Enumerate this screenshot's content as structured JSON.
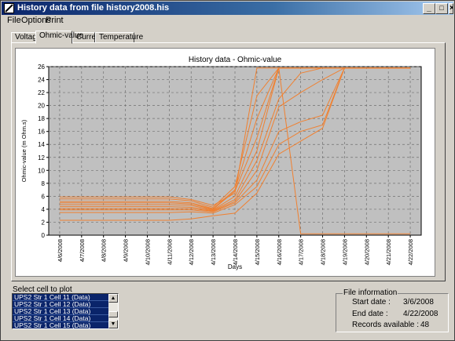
{
  "window": {
    "title": "History data from file history2008.his",
    "controls": [
      "_",
      "□",
      "×"
    ]
  },
  "menu": [
    "File",
    "Options",
    "Print"
  ],
  "tabs": [
    {
      "label": "Voltage",
      "active": false
    },
    {
      "label": "Ohmic-value",
      "active": true
    },
    {
      "label": "Current",
      "active": false
    },
    {
      "label": "Temperature",
      "active": false
    }
  ],
  "chart_data": {
    "type": "line",
    "title": "History data - Ohmic-value",
    "xlabel": "Days",
    "ylabel": "Ohmic-value (m Ohm.s)",
    "categories": [
      "4/6/2008",
      "4/7/2008",
      "4/8/2008",
      "4/9/2008",
      "4/10/2008",
      "4/11/2008",
      "4/12/2008",
      "4/13/2008",
      "4/14/2008",
      "4/15/2008",
      "4/16/2008",
      "4/17/2008",
      "4/18/2008",
      "4/19/2008",
      "4/20/2008",
      "4/21/2008",
      "4/22/2008"
    ],
    "ylim": [
      0,
      26
    ],
    "yticks": [
      0,
      2,
      4,
      6,
      8,
      10,
      12,
      14,
      16,
      18,
      20,
      22,
      24,
      26
    ],
    "grid": true,
    "line_color": "#f08030",
    "plot_bg": "#c0c0c0",
    "series": [
      {
        "values": [
          5.9,
          5.9,
          5.9,
          5.9,
          5.9,
          5.9,
          5.5,
          4.6,
          6.5,
          25.8,
          25.8,
          25.8,
          25.8,
          25.8,
          25.8,
          25.8,
          25.8
        ]
      },
      {
        "values": [
          5.6,
          5.6,
          5.6,
          5.6,
          5.6,
          5.6,
          5.3,
          4.3,
          7.5,
          21.5,
          25.8,
          25.8,
          25.8,
          25.8,
          25.8,
          25.8,
          25.8
        ]
      },
      {
        "values": [
          5.2,
          5.2,
          5.2,
          5.2,
          5.2,
          5.2,
          5.0,
          4.1,
          7.0,
          18.0,
          25.8,
          25.8,
          25.8,
          25.8,
          25.8,
          25.8,
          25.8
        ]
      },
      {
        "values": [
          5.0,
          5.0,
          5.0,
          5.0,
          5.0,
          5.0,
          4.8,
          4.0,
          6.8,
          15.0,
          25.8,
          25.8,
          25.8,
          25.8,
          25.8,
          25.8,
          25.8
        ]
      },
      {
        "values": [
          4.7,
          4.7,
          4.7,
          4.7,
          4.7,
          4.7,
          4.6,
          3.9,
          6.0,
          13.0,
          25.8,
          0.2,
          0.2,
          0.2,
          0.2,
          0.2,
          0.2
        ]
      },
      {
        "values": [
          4.4,
          4.4,
          4.4,
          4.4,
          4.4,
          4.4,
          4.3,
          3.8,
          5.5,
          11.5,
          21.0,
          25.0,
          25.8,
          25.8,
          25.8,
          25.8,
          25.8
        ]
      },
      {
        "values": [
          4.1,
          4.1,
          4.1,
          4.1,
          4.1,
          4.1,
          4.1,
          3.7,
          5.2,
          10.0,
          19.8,
          22.0,
          24.0,
          25.8,
          25.8,
          25.8,
          25.8
        ]
      },
      {
        "values": [
          3.9,
          3.9,
          3.9,
          3.9,
          3.9,
          3.9,
          3.9,
          3.6,
          5.0,
          8.5,
          16.0,
          17.5,
          18.5,
          25.8,
          25.8,
          25.8,
          25.8
        ]
      },
      {
        "values": [
          3.5,
          3.5,
          3.5,
          3.5,
          3.5,
          3.5,
          3.6,
          3.4,
          4.7,
          7.5,
          14.0,
          16.0,
          17.0,
          25.8,
          25.8,
          25.8,
          25.8
        ]
      },
      {
        "values": [
          2.3,
          2.3,
          2.3,
          2.3,
          2.3,
          2.3,
          2.5,
          3.0,
          3.4,
          6.5,
          12.5,
          14.5,
          16.5,
          25.8,
          25.8,
          25.8,
          25.8
        ]
      }
    ]
  },
  "select_label": "Select cell to plot",
  "cells": [
    "UPS2 Str 1 Cell 11 (Data)",
    "UPS2 Str 1 Cell 12 (Data)",
    "UPS2 Str 1 Cell 13 (Data)",
    "UPS2 Str 1 Cell 14 (Data)",
    "UPS2 Str 1 Cell 15 (Data)",
    "UPS2 Str 1 Cell 16 (Data)"
  ],
  "file_info": {
    "legend": "File information",
    "start_label": "Start date :",
    "start_value": "3/6/2008",
    "end_label": "End date :",
    "end_value": "4/22/2008",
    "records_label": "Records available :",
    "records_value": "48"
  }
}
